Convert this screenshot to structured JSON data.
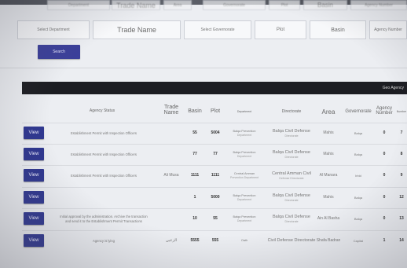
{
  "ghost_row": {
    "items": [
      "Department",
      "Trade Name",
      "Area",
      "Governorate",
      "Plot",
      "Basin",
      "Agency Number"
    ]
  },
  "filters": {
    "department": "Select Department",
    "trade_name": "Trade Name",
    "governorate": "Select Governorate",
    "plot": "Plot",
    "basin": "Basin",
    "agency_number": "Agency Number"
  },
  "search_label": "Search",
  "table": {
    "bar_title": "Geo Agency",
    "headers": {
      "status": "Agency Status",
      "trade_name": "Trade Name",
      "basin": "Basin",
      "plot": "Plot",
      "department": "Department",
      "directorate": "Directorate",
      "area": "Area",
      "governorate": "Governorate",
      "agency_number": "Agency Number",
      "number": "Number"
    },
    "rows": [
      {
        "view": "View",
        "status": "Establishment Permit with Inspection Officers",
        "status2": "",
        "trade_name": "",
        "basin": "55",
        "plot": "5004",
        "department": "Balqa Prevention",
        "department2": "Department",
        "directorate": "Balqa Civil Defense",
        "directorate2": "Directorate",
        "area": "Mahis",
        "governorate": "Balqa",
        "agency_number": "0",
        "number": "7"
      },
      {
        "view": "View",
        "status": "Establishment Permit with Inspection Officers",
        "status2": "",
        "trade_name": "",
        "basin": "77",
        "plot": "77",
        "department": "Balqa Prevention",
        "department2": "Department",
        "directorate": "Balqa Civil Defense",
        "directorate2": "Directorate",
        "area": "Mahis",
        "governorate": "Balqa",
        "agency_number": "0",
        "number": "8"
      },
      {
        "view": "View",
        "status": "Establishment Permit with Inspection Officers",
        "status2": "",
        "trade_name": "Ali Musa",
        "basin": "1111",
        "plot": "1111",
        "department": "Central Amman",
        "department2": "Prevention Department",
        "directorate": "Central Amman Civil",
        "directorate2": "Defense Directorate",
        "area": "Al Manara",
        "governorate": "Irbid",
        "agency_number": "0",
        "number": "9"
      },
      {
        "view": "View",
        "status": "",
        "status2": "",
        "trade_name": "",
        "basin": "1",
        "plot": "5000",
        "department": "Balqa Prevention",
        "department2": "Department",
        "directorate": "Balqa Civil Defense",
        "directorate2": "Directorate",
        "area": "Mahis",
        "governorate": "Balqa",
        "agency_number": "0",
        "number": "12"
      },
      {
        "view": "View",
        "status": "Initial approval by the administration. Archive the transaction",
        "status2": "and send it to the Establishment Permit Transactions",
        "trade_name": "",
        "basin": "10",
        "plot": "55",
        "department": "Balqa Prevention",
        "department2": "Department",
        "directorate": "Balqa Civil Defense",
        "directorate2": "Directorate",
        "area": "Ain Al Basha",
        "governorate": "Balqa",
        "agency_number": "0",
        "number": "13"
      },
      {
        "view": "View",
        "status": "Agency is lying",
        "status2": "",
        "trade_name": "الزعبي",
        "basin": "5555",
        "plot": "555",
        "department": "Oath",
        "department2": "",
        "directorate": "Civil Defense Directorate",
        "directorate2": "",
        "area": "Shafa Badran",
        "governorate": "Capital",
        "agency_number": "1",
        "number": "14"
      }
    ]
  },
  "colors": {
    "view_button": "#2f3790",
    "search_button": "#3b3f9a",
    "table_bar": "#1c1d22"
  }
}
